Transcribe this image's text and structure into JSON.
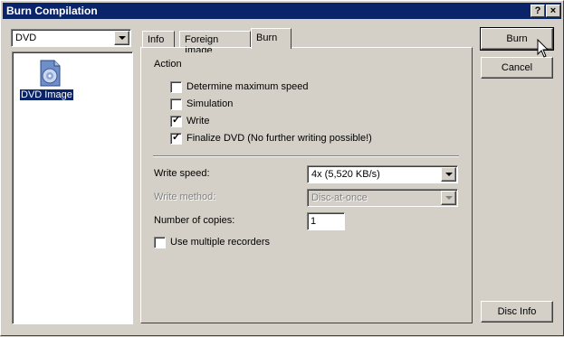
{
  "window": {
    "title": "Burn Compilation",
    "help_button": "?",
    "close_button": "×"
  },
  "left": {
    "recorder_combo_value": "DVD",
    "list_items": [
      {
        "label": "DVD Image",
        "icon": "dvd-image-icon",
        "selected": true
      }
    ]
  },
  "tabs": [
    {
      "label": "Info",
      "active": false
    },
    {
      "label": "Foreign Image",
      "active": false
    },
    {
      "label": "Burn",
      "active": true
    }
  ],
  "burn": {
    "action_label": "Action",
    "options": [
      {
        "label": "Determine maximum speed",
        "checked": false
      },
      {
        "label": "Simulation",
        "checked": false
      },
      {
        "label": "Write",
        "checked": true
      },
      {
        "label": "Finalize DVD (No further writing possible!)",
        "checked": true
      }
    ],
    "write_speed_label": "Write speed:",
    "write_speed_value": "4x (5,520 KB/s)",
    "write_method_label": "Write method:",
    "write_method_value": "Disc-at-once",
    "copies_label": "Number of copies:",
    "copies_value": "1",
    "multiple_recorders_label": "Use multiple recorders",
    "multiple_recorders_checked": false
  },
  "buttons": {
    "burn": "Burn",
    "cancel": "Cancel",
    "disc_info": "Disc Info"
  },
  "colors": {
    "titlebar": "#0a246a",
    "face": "#d4d0c8",
    "selection": "#0a246a"
  }
}
